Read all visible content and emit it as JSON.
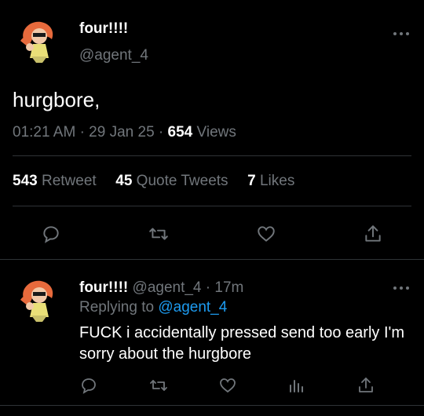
{
  "main_tweet": {
    "name": "four!!!!",
    "handle": "@agent_4",
    "text": "hurgbore,",
    "time": "01:21 AM",
    "sep1": "·",
    "date": "29 Jan 25",
    "sep2": "·",
    "views_count": "654",
    "views_label": "Views",
    "retweets_count": "543",
    "retweets_label": "Retweet",
    "quotes_count": "45",
    "quotes_label": "Quote Tweets",
    "likes_count": "7",
    "likes_label": "Likes"
  },
  "reply": {
    "name": "four!!!!",
    "handle": "@agent_4",
    "sep": "·",
    "time_ago": "17m",
    "replying_prefix": "Replying to",
    "replying_to": "@agent_4",
    "text": "FUCK i accidentally pressed send too early I'm sorry about the hurgbore"
  },
  "icons": [
    "more-icon",
    "reply-icon",
    "retweet-icon",
    "like-icon",
    "share-icon",
    "analytics-icon"
  ],
  "colors": {
    "background": "#000000",
    "text": "#e7e9ea",
    "muted": "#71767b",
    "link": "#1d9bf0",
    "divider": "#2f3336"
  }
}
